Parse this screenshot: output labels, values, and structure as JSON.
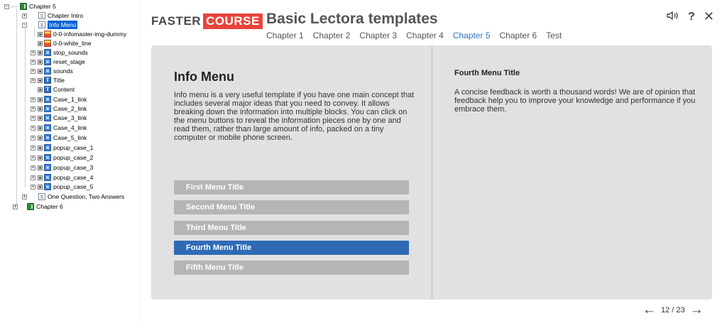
{
  "tree": {
    "items": [
      {
        "label": "Chapter 5",
        "icon": "chapter-icon"
      },
      {
        "label": "Chapter Intro",
        "icon": "page-icon"
      },
      {
        "label": "Info Menu",
        "icon": "page-icon"
      },
      {
        "label": "0-0-infomaster-img-dummy",
        "icon": "image-icon"
      },
      {
        "label": "0-0-white_line",
        "icon": "image-icon"
      },
      {
        "label": "stop_sounds",
        "icon": "action-icon"
      },
      {
        "label": "reset_stage",
        "icon": "action-icon"
      },
      {
        "label": "sounds",
        "icon": "action-icon"
      },
      {
        "label": "Title",
        "icon": "text-icon"
      },
      {
        "label": "Content",
        "icon": "text-icon"
      },
      {
        "label": "Case_1_link",
        "icon": "action-icon"
      },
      {
        "label": "Case_2_link",
        "icon": "action-icon"
      },
      {
        "label": "Case_3_link",
        "icon": "action-icon"
      },
      {
        "label": "Case_4_link",
        "icon": "action-icon"
      },
      {
        "label": "Case_5_link",
        "icon": "action-icon"
      },
      {
        "label": "popup_case_1",
        "icon": "action-icon"
      },
      {
        "label": "popup_case_2",
        "icon": "action-icon"
      },
      {
        "label": "popup_case_3",
        "icon": "action-icon"
      },
      {
        "label": "popup_case_4",
        "icon": "action-icon"
      },
      {
        "label": "popup_case_5",
        "icon": "action-icon"
      },
      {
        "label": "One Question, Two Answers",
        "icon": "page-icon"
      },
      {
        "label": "Chapter 6",
        "icon": "chapter-icon"
      }
    ]
  },
  "header": {
    "brand_left": "FASTER",
    "brand_right": "COURSE",
    "title": "Basic Lectora templates",
    "chapters": [
      "Chapter 1",
      "Chapter 2",
      "Chapter 3",
      "Chapter 4",
      "Chapter 5",
      "Chapter 6",
      "Test"
    ],
    "active_chapter": "Chapter 5",
    "icons": {
      "sound": "🔈",
      "help": "?",
      "close": "✕"
    }
  },
  "content": {
    "heading": "Info Menu",
    "body": "Info menu is a very useful template if you have one main concept that includes several major ideas that you need to convey. It allows breaking down the information into multiple blocks. You can click on the menu buttons to reveal the information pieces one by one and read them, rather than large amount of info, packed on a tiny computer or mobile phone screen.",
    "menu": [
      "First Menu Title",
      "Second Menu Title",
      "Third Menu Title",
      "Fourth Menu Title",
      "Fifth Menu Title"
    ],
    "active_menu": "Fourth Menu Title",
    "feedback_title": "Fourth Menu Title",
    "feedback_body": "A concise feedback is worth a thousand words! We are of opinion that feedback help you to improve your knowledge and performance if you embrace them."
  },
  "pager": {
    "prev": "←",
    "count": "12 / 23",
    "next": "→"
  },
  "colors": {
    "accent": "#2f6bb5",
    "brand_red": "#e8443c",
    "menu_inactive": "#b5b5b5",
    "panel": "#e1e1e1"
  }
}
